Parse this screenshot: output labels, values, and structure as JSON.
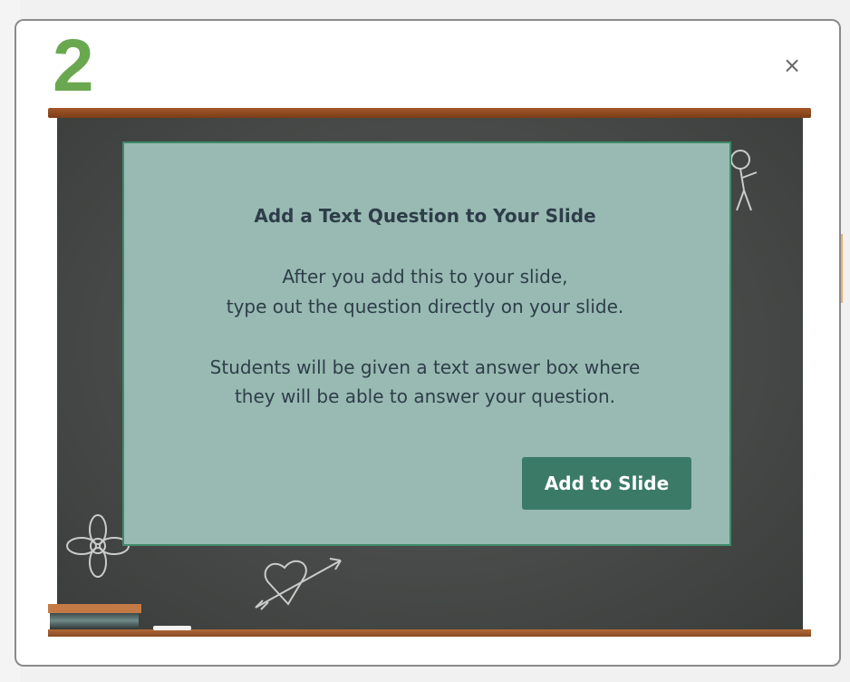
{
  "modal": {
    "step_number": "2",
    "close_label": "×"
  },
  "dialog": {
    "title": "Add a Text Question to Your Slide",
    "line1": "After you add this to your slide,",
    "line2": "type out the question directly on your slide.",
    "line3": "Students will be given a text answer box where",
    "line4": "they will be able to answer your question.",
    "button_label": "Add to Slide"
  },
  "icons": {
    "close": "close-icon",
    "flower": "flower-doodle-icon",
    "heart": "heart-arrow-doodle-icon",
    "stick_figure": "stick-figure-doodle-icon"
  },
  "colors": {
    "step_number": "#6aa84f",
    "panel_bg": "#98bab2",
    "button_bg": "#3c7a68",
    "text": "#2e3d4a"
  }
}
